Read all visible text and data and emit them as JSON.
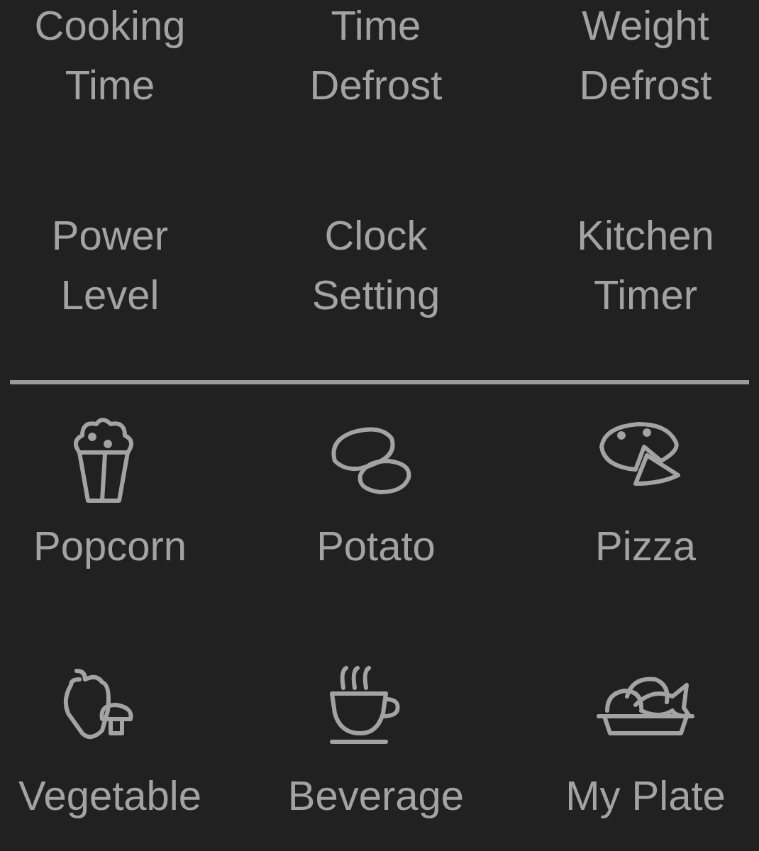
{
  "settings": [
    {
      "lines": [
        "Cooking",
        "Time"
      ]
    },
    {
      "lines": [
        "Time",
        "Defrost"
      ]
    },
    {
      "lines": [
        "Weight",
        "Defrost"
      ]
    },
    {
      "lines": [
        "Power",
        "Level"
      ]
    },
    {
      "lines": [
        "Clock",
        "Setting"
      ]
    },
    {
      "lines": [
        "Kitchen",
        "Timer"
      ]
    }
  ],
  "foods": [
    {
      "label": "Popcorn"
    },
    {
      "label": "Potato"
    },
    {
      "label": "Pizza"
    },
    {
      "label": "Vegetable"
    },
    {
      "label": "Beverage"
    },
    {
      "label": "My Plate"
    }
  ]
}
